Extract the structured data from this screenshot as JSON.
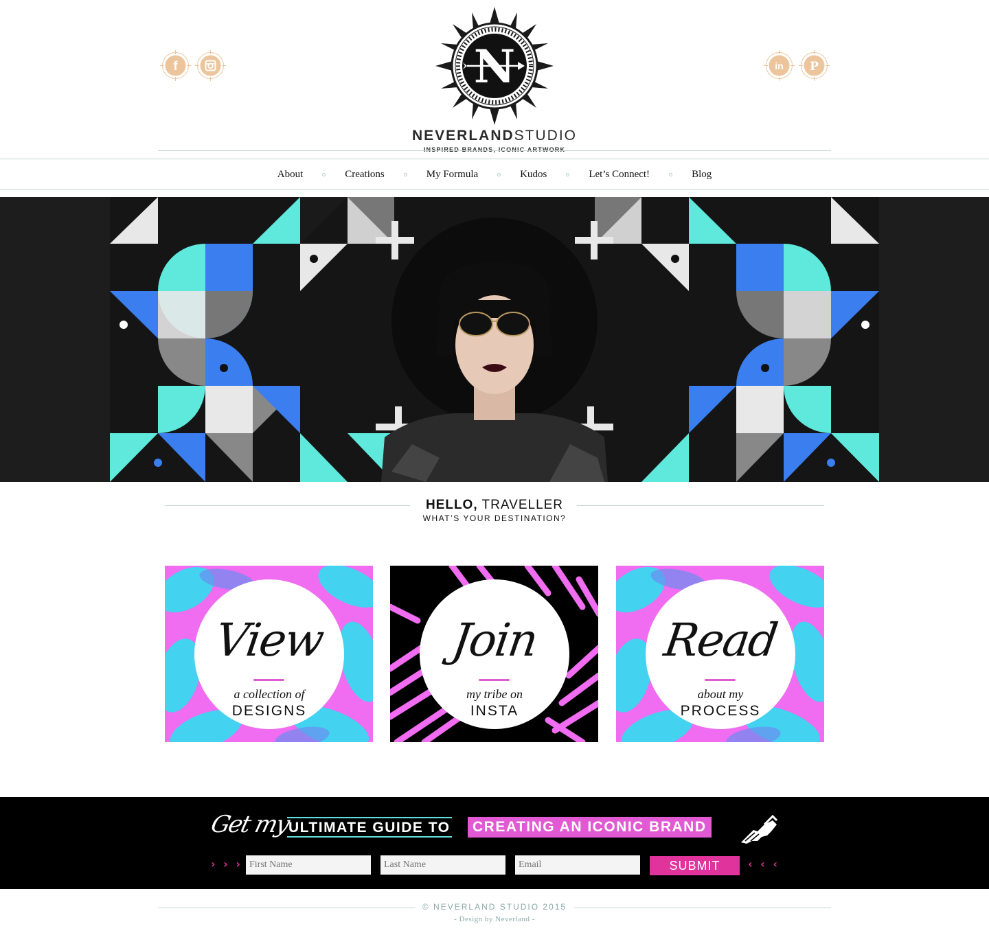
{
  "brand": {
    "name_bold": "NEVERLAND",
    "name_light": "STUDIO",
    "tagline": "INSPIRED BRANDS, ICONIC ARTWORK",
    "logo_letter": "N"
  },
  "social": {
    "left": [
      {
        "name": "facebook-icon",
        "glyph": "f"
      },
      {
        "name": "instagram-icon",
        "glyph": "◙"
      }
    ],
    "right": [
      {
        "name": "linkedin-icon",
        "glyph": "in"
      },
      {
        "name": "pinterest-icon",
        "glyph": "P"
      }
    ],
    "accent": "#e9b98a"
  },
  "nav": {
    "items": [
      "About",
      "Creations",
      "My Formula",
      "Kudos",
      "Let’s Connect!",
      "Blog"
    ]
  },
  "hello": {
    "title_bold": "HELLO,",
    "title_light": " TRAVELLER",
    "subtitle": "WHAT’S YOUR DESTINATION?"
  },
  "cards": [
    {
      "script": "View",
      "small": "a collection of",
      "big": "DESIGNS"
    },
    {
      "script": "Join",
      "small": "my tribe on",
      "big": "INSTA"
    },
    {
      "script": "Read",
      "small": "about my",
      "big": "PROCESS"
    }
  ],
  "signup": {
    "get_my": "Get my",
    "guide_part1": "ULTIMATE GUIDE TO",
    "guide_part2": "CREATING AN ICONIC BRAND",
    "arrows_left": "› › ›",
    "arrows_right": "‹ ‹ ‹",
    "first_name_placeholder": "First Name",
    "last_name_placeholder": "Last Name",
    "email_placeholder": "Email",
    "submit_label": "SUBMIT",
    "accent_pink": "#e0339c",
    "accent_teal": "#5fe0d8"
  },
  "footer": {
    "copyright": "© NEVERLAND STUDIO 2015",
    "credit": "- Design by Neverland -"
  },
  "colors": {
    "rule": "#c3d6d3",
    "footer_text": "#8aa9a6",
    "hero_teal": "#5fe8dc",
    "hero_blue": "#3a7ef0",
    "card_pink": "#f06cf0",
    "card_cyan": "#3ad8f0"
  }
}
